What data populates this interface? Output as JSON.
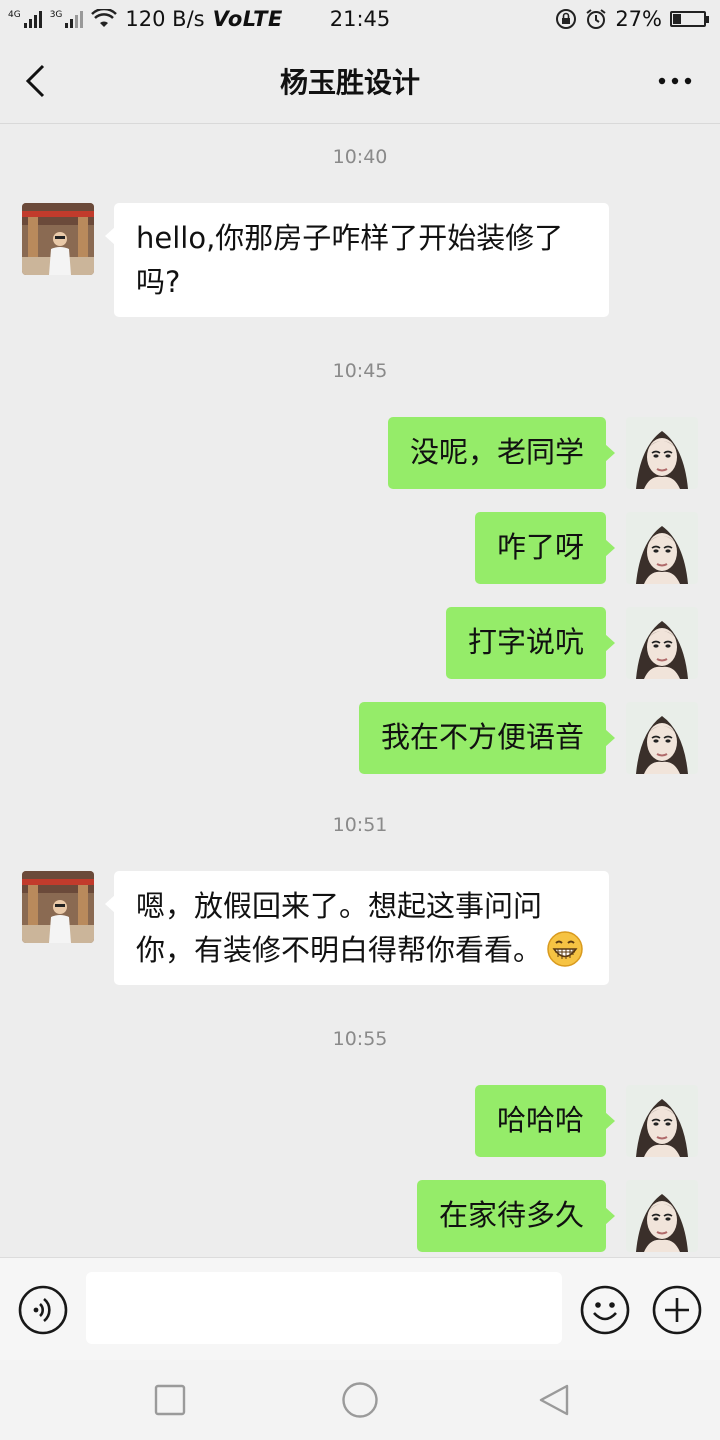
{
  "status_bar": {
    "net_4g": "4G",
    "net_3g": "3G",
    "speed": "120 B/s",
    "volte": "VoLTE",
    "time": "21:45",
    "battery": "27%",
    "battery_level": 0.27
  },
  "header": {
    "title": "杨玉胜设计",
    "back_icon": "chevron-left-icon",
    "more_icon": "more-dots-icon"
  },
  "messages": [
    {
      "type": "time",
      "text": "10:40"
    },
    {
      "type": "in",
      "text": "hello,你那房子咋样了开始装修了吗?"
    },
    {
      "type": "time",
      "text": "10:45"
    },
    {
      "type": "out",
      "text": "没呢，老同学"
    },
    {
      "type": "out",
      "text": "咋了呀"
    },
    {
      "type": "out",
      "text": "打字说吭"
    },
    {
      "type": "out",
      "text": "我在不方便语音"
    },
    {
      "type": "time",
      "text": "10:51"
    },
    {
      "type": "in",
      "text": "嗯，放假回来了。想起这事问问你，有装修不明白得帮你看看。",
      "emoji": "grinning-face-emoji"
    },
    {
      "type": "time",
      "text": "10:55"
    },
    {
      "type": "out",
      "text": "哈哈哈"
    },
    {
      "type": "out",
      "text": "在家待多久"
    }
  ],
  "input_bar": {
    "placeholder": "",
    "voice_icon": "voice-icon",
    "emoji_icon": "smiley-icon",
    "plus_icon": "plus-icon"
  },
  "nav_bar": {
    "recent_icon": "square-icon",
    "home_icon": "circle-icon",
    "back_icon": "triangle-back-icon"
  },
  "colors": {
    "background": "#ededed",
    "outgoing_bubble": "#95ec69",
    "incoming_bubble": "#ffffff",
    "timestamp": "#8a8a8a"
  }
}
